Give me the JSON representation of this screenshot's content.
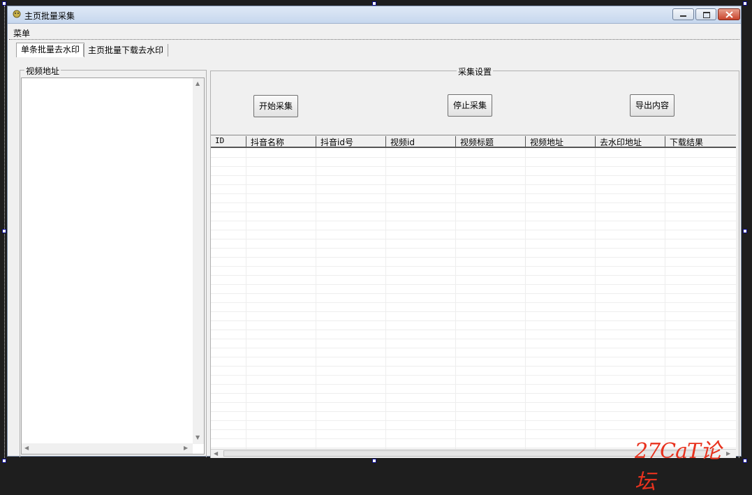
{
  "window": {
    "title": "主页批量采集"
  },
  "menu": {
    "label": "菜单"
  },
  "tabs": [
    {
      "label": "单条批量去水印"
    },
    {
      "label": "主页批量下载去水印"
    }
  ],
  "left_group": {
    "caption": "视频地址"
  },
  "right_group": {
    "caption": "采集设置"
  },
  "buttons": {
    "start": "开始采集",
    "stop": "停止采集",
    "export": "导出内容"
  },
  "table": {
    "columns": [
      "ID",
      "抖音名称",
      "抖音id号",
      "视频id",
      "视频标题",
      "视频地址",
      "去水印地址",
      "下载结果"
    ],
    "rows": []
  },
  "watermark": "27CaT论坛"
}
